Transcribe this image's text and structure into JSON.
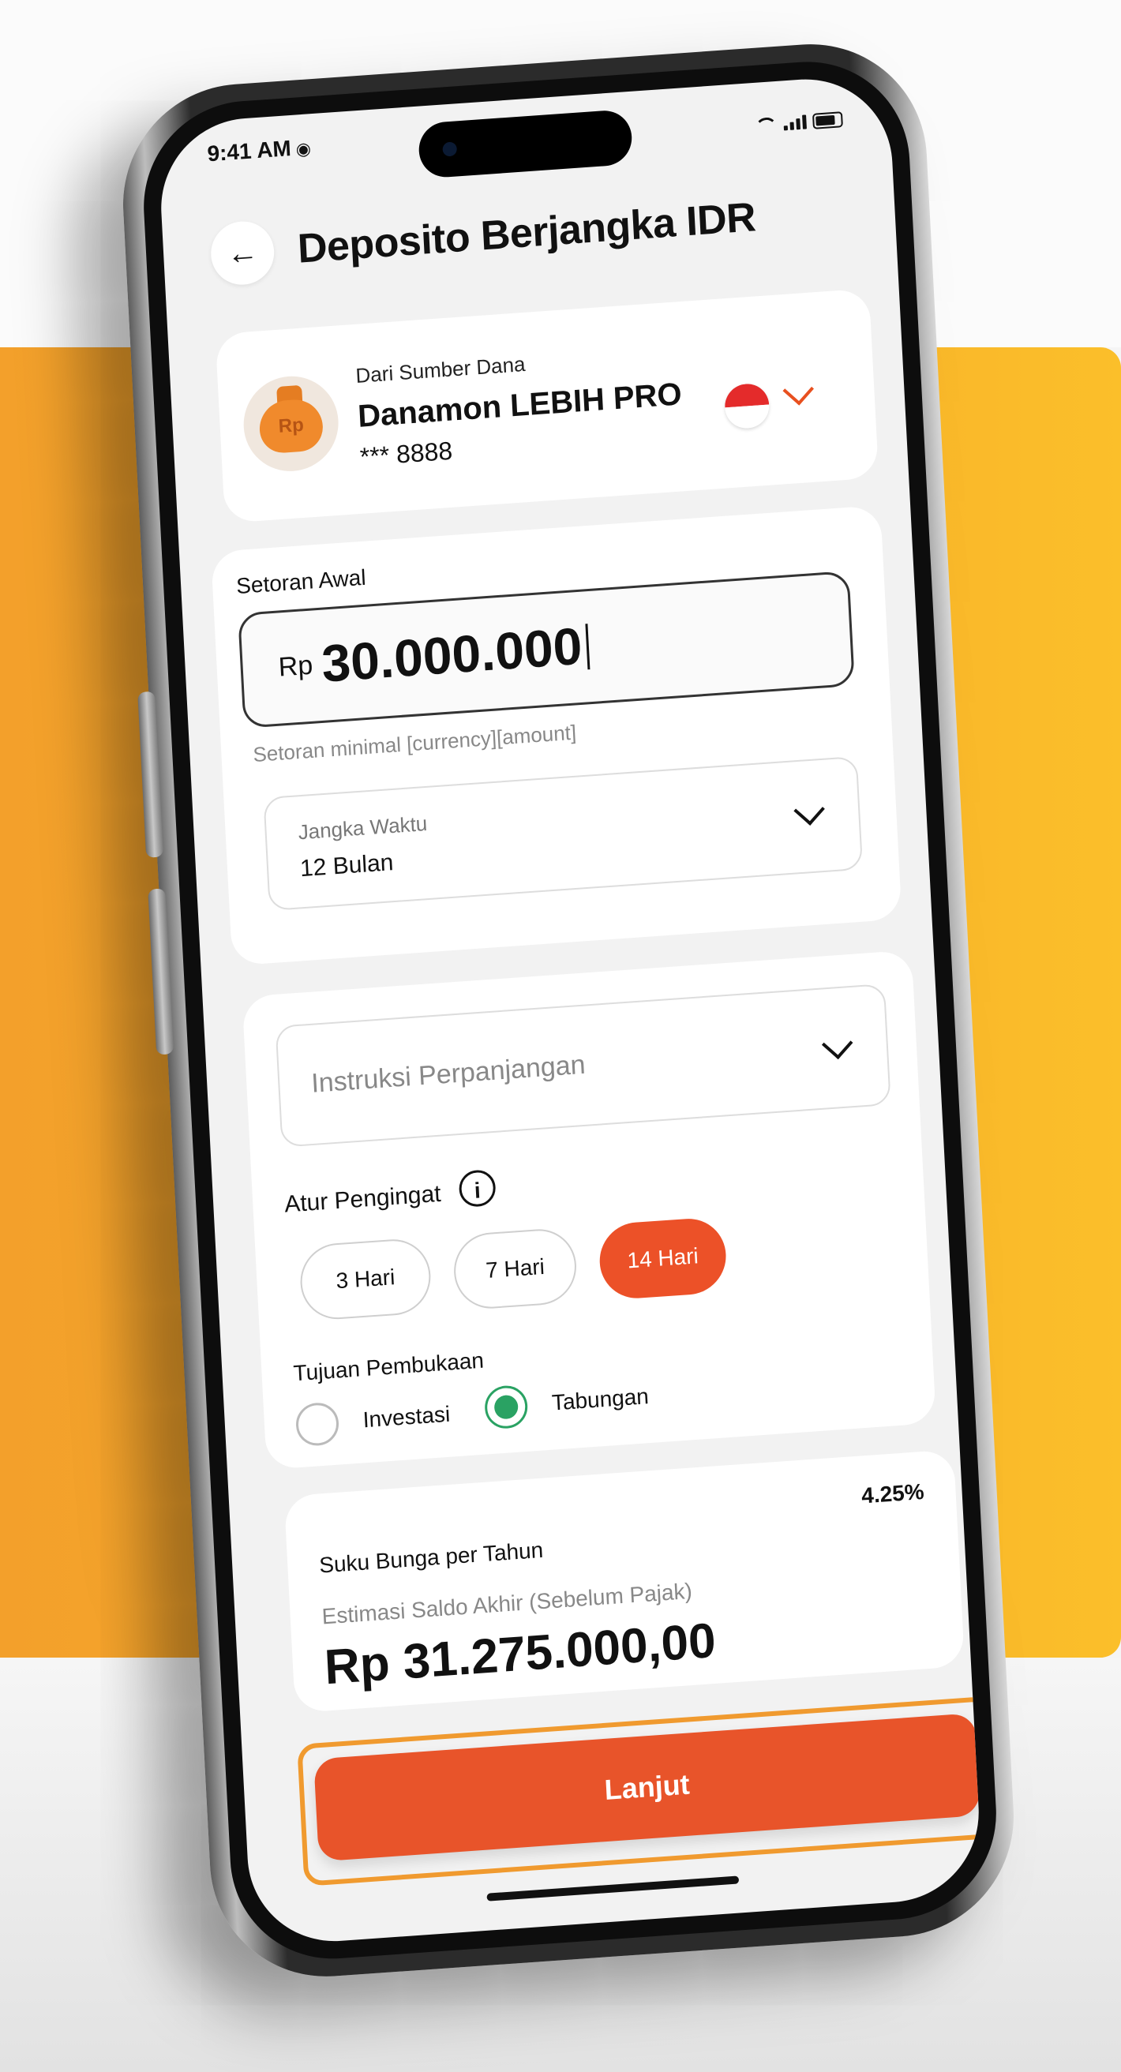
{
  "status_bar": {
    "time": "9:41 AM"
  },
  "header": {
    "title": "Deposito Berjangka IDR"
  },
  "source": {
    "caption": "Dari Sumber Dana",
    "name": "Danamon LEBIH PRO",
    "account": "*** 8888",
    "currency_symbol": "Rp"
  },
  "deposit": {
    "label": "Setoran Awal",
    "currency": "Rp",
    "amount": "30.000.000",
    "minimum_note": "Setoran minimal [currency][amount]"
  },
  "tenor": {
    "label": "Jangka Waktu",
    "value": "12 Bulan"
  },
  "renewal": {
    "placeholder": "Instruksi Perpanjangan"
  },
  "reminder": {
    "label": "Atur Pengingat",
    "options": [
      "3 Hari",
      "7 Hari",
      "14 Hari"
    ],
    "selected": "14 Hari"
  },
  "purpose": {
    "label": "Tujuan Pembukaan",
    "options": [
      "Investasi",
      "Tabungan"
    ],
    "selected": "Tabungan"
  },
  "interest": {
    "rate_label": "Suku Bunga per Tahun",
    "rate_value": "4.25%",
    "estimate_label": "Estimasi Saldo Akhir (Sebelum Pajak)",
    "estimate_value": "Rp 31.275.000,00"
  },
  "actions": {
    "continue_label": "Lanjut"
  },
  "colors": {
    "primary": "#e8542a",
    "highlight": "#f09a2f",
    "success": "#2aa263",
    "background_accent": "#f7ad2a"
  }
}
